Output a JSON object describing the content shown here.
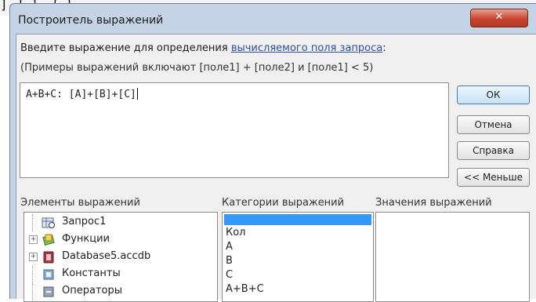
{
  "backdrop": {
    "left_bracket": "]",
    "middle": "[ ]",
    "right": "[ ]"
  },
  "window": {
    "title": "Построитель выражений",
    "close_glyph": "✕"
  },
  "prompt": {
    "line1_prefix": "Введите выражение для определения ",
    "line1_link": "вычисляемого поля запроса",
    "line1_suffix": ":",
    "line2": "(Примеры выражений включают [поле1] + [поле2] и [поле1] < 5)"
  },
  "expression": {
    "value": "A+B+C: [A]+[B]+[C]"
  },
  "buttons": {
    "ok": "ОК",
    "cancel": "Отмена",
    "help": "Справка",
    "less": "<< Меньше"
  },
  "sections": {
    "elements_label": "Элементы выражений",
    "categories_label": "Категории выражений",
    "values_label": "Значения выражений"
  },
  "elements_tree": [
    {
      "label": "Запрос1",
      "expandable": false,
      "icon": "query-icon"
    },
    {
      "label": "Функции",
      "expandable": true,
      "icon": "functions-icon"
    },
    {
      "label": "Database5.accdb",
      "expandable": true,
      "icon": "database-icon"
    },
    {
      "label": "Константы",
      "expandable": false,
      "icon": "constants-icon"
    },
    {
      "label": "Операторы",
      "expandable": false,
      "icon": "operators-icon"
    }
  ],
  "categories": [
    "Кол",
    "A",
    "B",
    "C",
    "A+B+C"
  ],
  "colors": {
    "selection": "#3399ff",
    "link": "#2a4fb0",
    "frame": "#c5d3e6"
  }
}
